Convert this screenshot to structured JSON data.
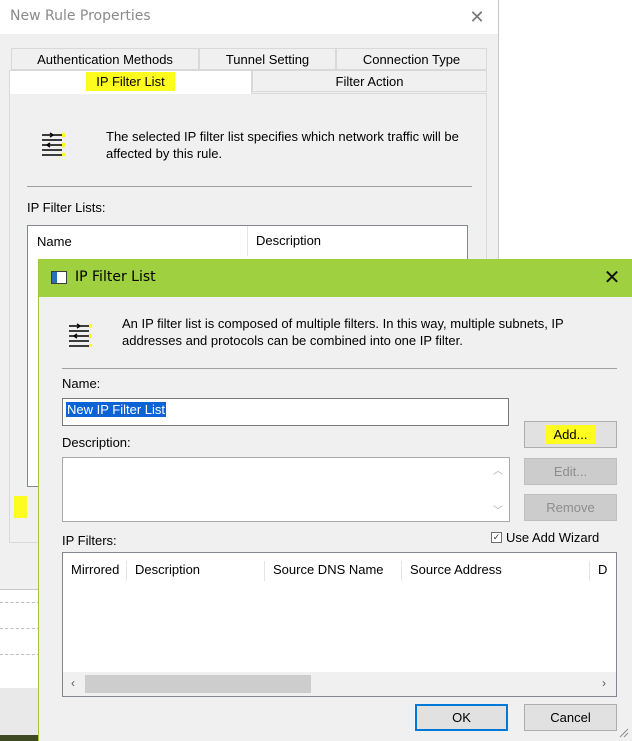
{
  "rule_window": {
    "title": "New Rule Properties",
    "tabs_row1": [
      "Authentication Methods",
      "Tunnel Setting",
      "Connection Type"
    ],
    "tabs_row2": [
      "IP Filter List",
      "Filter Action"
    ],
    "info_text": "The selected IP filter list specifies which network traffic will be affected by this rule.",
    "lists_label": "IP Filter Lists:",
    "columns": [
      "Name",
      "Description"
    ]
  },
  "dialog": {
    "title": "IP Filter List",
    "info_text": "An IP filter list is composed of multiple filters. In this way, multiple subnets, IP addresses and protocols can be combined into one IP filter.",
    "name_label": "Name:",
    "name_value": "New IP Filter List",
    "description_label": "Description:",
    "buttons": {
      "add": "Add...",
      "edit": "Edit...",
      "remove": "Remove",
      "ok": "OK",
      "cancel": "Cancel"
    },
    "use_wizard_label": "Use Add Wizard",
    "use_wizard_checked": true,
    "filters_label": "IP Filters:",
    "filter_columns": [
      "Mirrored",
      "Description",
      "Source DNS Name",
      "Source Address",
      "D"
    ]
  },
  "icons": [
    "close-icon",
    "filter-list-icon",
    "window-icon",
    "scroll-up-icon",
    "scroll-down-icon",
    "scroll-left-icon",
    "scroll-right-icon",
    "size-grip-icon"
  ],
  "colors": {
    "highlight": "#fdfc1e",
    "dialog_titlebar": "#9ed040",
    "selection": "#0b63d6",
    "focus_border": "#0078d7"
  }
}
